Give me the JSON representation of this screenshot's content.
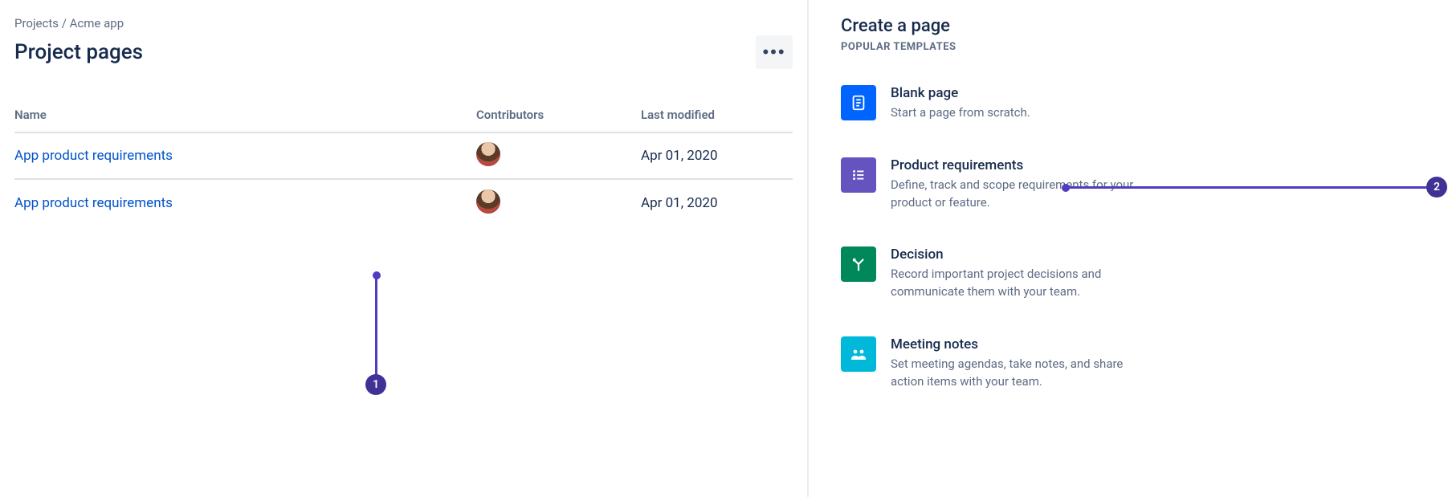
{
  "breadcrumbs": {
    "root": "Projects",
    "sep": " / ",
    "current": "Acme app"
  },
  "page": {
    "title": "Project pages",
    "more_label": "•••"
  },
  "table": {
    "headers": {
      "name": "Name",
      "contributors": "Contributors",
      "modified": "Last modified"
    },
    "rows": [
      {
        "name": "App product requirements",
        "modified": "Apr 01, 2020"
      },
      {
        "name": "App product requirements",
        "modified": "Apr 01, 2020"
      }
    ]
  },
  "sidebar": {
    "title": "Create a page",
    "subhead": "POPULAR TEMPLATES",
    "templates": [
      {
        "key": "blank",
        "title": "Blank page",
        "desc": "Start a page from scratch."
      },
      {
        "key": "preq",
        "title": "Product requirements",
        "desc": "Define, track and scope requirements for your product or feature."
      },
      {
        "key": "dec",
        "title": "Decision",
        "desc": "Record important project decisions and communicate them with your team."
      },
      {
        "key": "mtg",
        "title": "Meeting notes",
        "desc": "Set meeting agendas, take notes, and share action items with your team."
      }
    ]
  },
  "annotations": {
    "one": "1",
    "two": "2"
  }
}
